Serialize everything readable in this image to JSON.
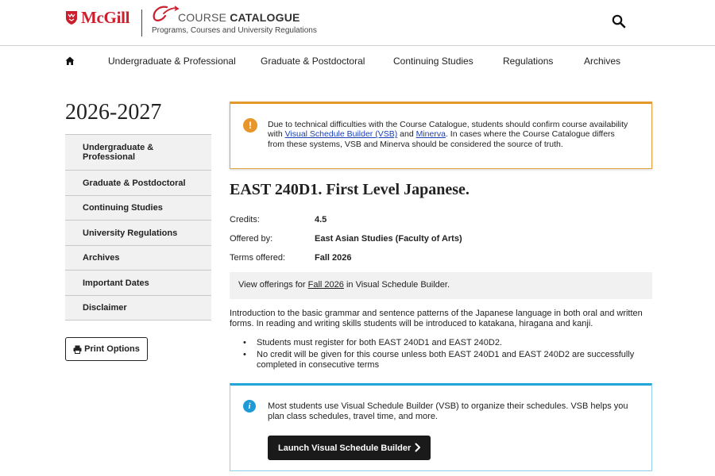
{
  "header": {
    "brand": "McGill",
    "catalogue_title_light": "COURSE",
    "catalogue_title_bold": "CATALOGUE",
    "catalogue_subtitle": "Programs, Courses and University Regulations",
    "search_icon": "search-icon",
    "brand_color": "#cc1f2e"
  },
  "nav": {
    "home_icon": "home-icon",
    "items": [
      {
        "label": "Undergraduate & Professional"
      },
      {
        "label": "Graduate & Postdoctoral"
      },
      {
        "label": "Continuing Studies"
      },
      {
        "label": "Regulations"
      },
      {
        "label": "Archives"
      }
    ]
  },
  "sidebar": {
    "year": "2026-2027",
    "items": [
      {
        "label": "Undergraduate & Professional"
      },
      {
        "label": "Graduate & Postdoctoral"
      },
      {
        "label": "Continuing Studies"
      },
      {
        "label": "University Regulations"
      },
      {
        "label": "Archives"
      },
      {
        "label": "Important Dates"
      },
      {
        "label": "Disclaimer"
      }
    ],
    "print_label": "Print Options",
    "print_icon": "print-icon"
  },
  "alert": {
    "icon": "exclamation-icon",
    "text_before": "Due to technical difficulties with the Course Catalogue, students should confirm course availability with ",
    "link_vsb": "Visual Schedule Builder (VSB)",
    "text_and": " and ",
    "link_minerva": "Minerva",
    "text_after": ". In cases where the Course Catalogue differs from these systems, VSB and Minerva should be considered the source of truth.",
    "accent": "#e39a2b"
  },
  "course": {
    "title": "EAST 240D1. First Level Japanese.",
    "credits_label": "Credits:",
    "credits_value": "4.5",
    "offered_label": "Offered by:",
    "offered_value": "East Asian Studies (Faculty of Arts)",
    "terms_label": "Terms offered:",
    "terms_value": "Fall 2026",
    "offerings_before": "View offerings for ",
    "offerings_link": "Fall 2026",
    "offerings_after": " in Visual Schedule Builder.",
    "description": "Introduction to the basic grammar and sentence patterns of the Japanese language in both oral and written forms. In reading and writing skills students will be introduced to katakana, hiragana and kanji.",
    "notes": [
      "Students must register for both EAST 240D1 and EAST 240D2.",
      "No credit will be given for this course unless both EAST 240D1 and EAST 240D2 are successfully completed in consecutive terms"
    ]
  },
  "vsb": {
    "icon": "info-icon",
    "text": "Most students use Visual Schedule Builder (VSB) to organize their schedules. VSB helps you plan class schedules, travel time, and more.",
    "button_label": "Launch Visual Schedule Builder",
    "button_icon": "chevron-right-icon",
    "accent": "#22a6d9"
  }
}
